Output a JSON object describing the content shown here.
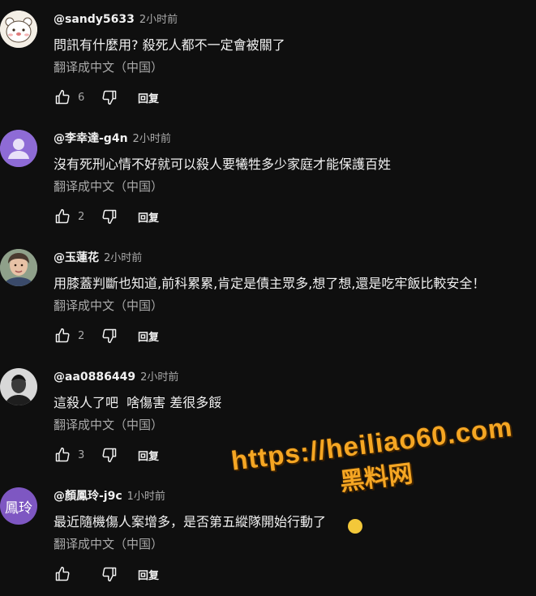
{
  "translate_label": "翻译成中文（中国）",
  "reply_label": "回复",
  "comments": [
    {
      "author": "@sandy5633",
      "time": "2小时前",
      "text": "問訊有什麼用? 殺死人都不一定會被關了",
      "likes": "6",
      "avatar": "cartoon-bear-avatar"
    },
    {
      "author": "@李幸達-g4n",
      "time": "2小时前",
      "text": "沒有死刑心情不好就可以殺人要犧牲多少家庭才能保護百姓",
      "likes": "2",
      "avatar": "default-person-avatar",
      "avatar_color": "#8e6bd6"
    },
    {
      "author": "@玉蓮花",
      "time": "2小时前",
      "text": "用膝蓋判斷也知道,前科累累,肯定是債主眾多,想了想,還是吃牢飯比較安全！",
      "likes": "2",
      "avatar": "photo-avatar"
    },
    {
      "author": "@aa0886449",
      "time": "2小时前",
      "text": "這殺人了吧  啥傷害 差很多餒",
      "likes": "3",
      "avatar": "photo-avatar-dark"
    },
    {
      "author": "@顏鳳玲-j9c",
      "time": "1小时前",
      "text": "最近隨機傷人案增多，是否第五縱隊開始行動了",
      "likes": "",
      "avatar": "initials-avatar",
      "avatar_text": "鳳玲",
      "avatar_color": "#7e57c2"
    }
  ],
  "watermark": {
    "url": "https://heiliao60.com",
    "name": "黑料网",
    "color": "#f5a623"
  }
}
